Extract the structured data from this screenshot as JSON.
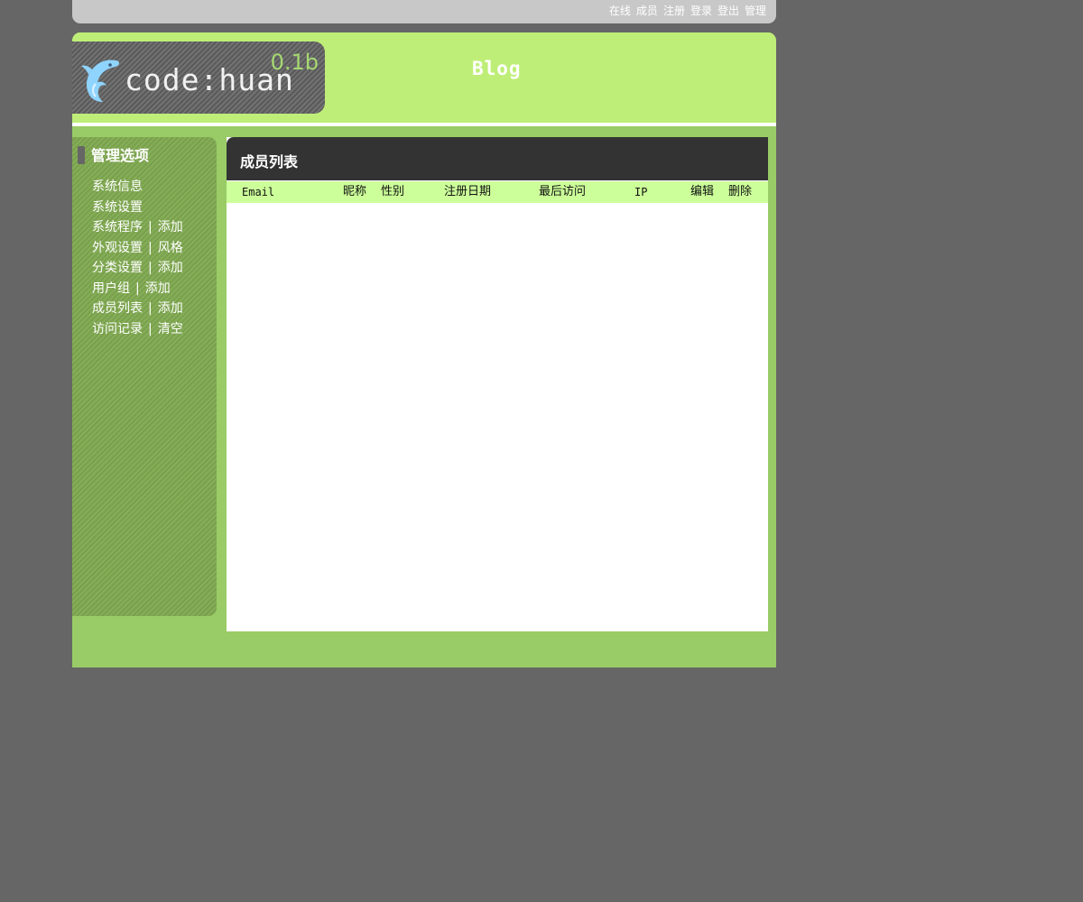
{
  "top_nav": [
    "在线",
    "成员",
    "注册",
    "登录",
    "登出",
    "管理"
  ],
  "logo": {
    "text": "code:huan",
    "version": "0.1b"
  },
  "site_title": "Blog",
  "sidebar": {
    "title": "管理选项",
    "separator": "|",
    "rows": [
      {
        "items": [
          "系统信息"
        ]
      },
      {
        "items": [
          "系统设置"
        ]
      },
      {
        "items": [
          "系统程序",
          "添加"
        ]
      },
      {
        "items": [
          "外观设置",
          "风格"
        ]
      },
      {
        "items": [
          "分类设置",
          "添加"
        ]
      },
      {
        "items": [
          "用户组",
          "添加"
        ]
      },
      {
        "items": [
          "成员列表",
          "添加"
        ]
      },
      {
        "items": [
          "访问记录",
          "清空"
        ]
      }
    ]
  },
  "main": {
    "title": "成员列表",
    "columns": [
      "Email",
      "昵称",
      "性别",
      "注册日期",
      "最后访问",
      "IP",
      "编辑",
      "删除"
    ]
  },
  "colors": {
    "background": "#666666",
    "header": "#bfee78",
    "page": "#99cc66",
    "table_header": "#ccff99",
    "panel_header": "#333333"
  }
}
